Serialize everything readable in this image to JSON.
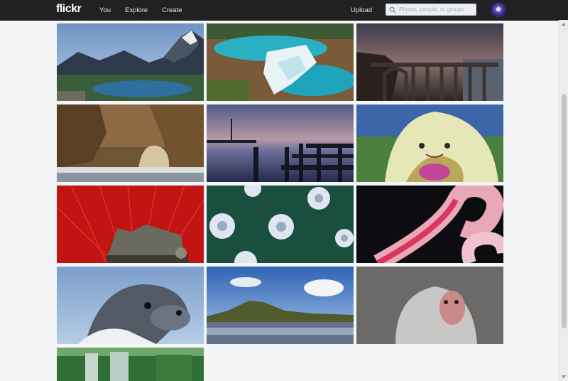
{
  "header": {
    "logo": "flickr",
    "nav": [
      {
        "label": "You"
      },
      {
        "label": "Explore"
      },
      {
        "label": "Create"
      }
    ],
    "upload_label": "Upload",
    "search": {
      "placeholder": "Photos, people, or groups"
    }
  },
  "gallery": {
    "photos": [
      {
        "subject": "mountain-lake"
      },
      {
        "subject": "turquoise-waterfall"
      },
      {
        "subject": "coastal-bridge"
      },
      {
        "subject": "sea-arch"
      },
      {
        "subject": "pier-at-dusk"
      },
      {
        "subject": "stingray"
      },
      {
        "subject": "quadriga-fireworks"
      },
      {
        "subject": "floating-ornaments"
      },
      {
        "subject": "pink-tentacle"
      },
      {
        "subject": "seal"
      },
      {
        "subject": "hill-landscape"
      },
      {
        "subject": "baboon"
      },
      {
        "subject": "jungle-waterfall"
      }
    ]
  }
}
